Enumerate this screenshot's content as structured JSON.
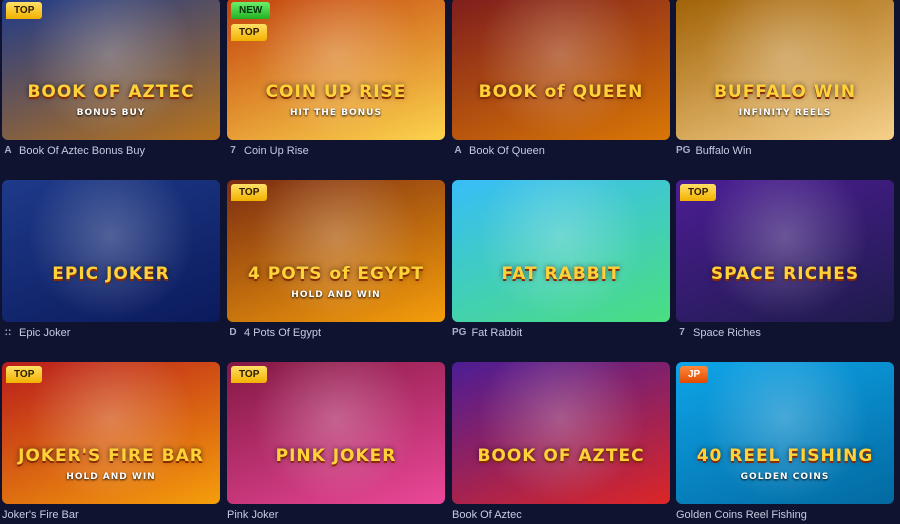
{
  "games": [
    {
      "title": "Book Of Aztec Bonus Buy",
      "art_text": "BOOK OF AZTEC",
      "art_sub": "BONUS BUY",
      "badges": [
        "TOP"
      ],
      "provider_icon": "A",
      "bg": [
        "#1e3a8a",
        "#b8731c"
      ]
    },
    {
      "title": "Coin Up Rise",
      "art_text": "COIN UP RISE",
      "art_sub": "HIT THE BONUS",
      "badges": [
        "NEW",
        "TOP"
      ],
      "provider_icon": "7",
      "bg": [
        "#c2410c",
        "#fcd34d"
      ]
    },
    {
      "title": "Book Of Queen",
      "art_text": "BOOK of QUEEN",
      "art_sub": "",
      "badges": [],
      "provider_icon": "A",
      "bg": [
        "#7f1d1d",
        "#d97706"
      ]
    },
    {
      "title": "Buffalo Win",
      "art_text": "BUFFALO WIN",
      "art_sub": "INFINITY REELS",
      "badges": [],
      "provider_icon": "PG",
      "bg": [
        "#a16207",
        "#f5d08a"
      ]
    },
    {
      "title": "Epic Joker",
      "art_text": "EPIC JOKER",
      "art_sub": "",
      "badges": [],
      "provider_icon": "::",
      "bg": [
        "#1e3a8a",
        "#0b1a5c"
      ]
    },
    {
      "title": "4 Pots Of Egypt",
      "art_text": "4 POTS of EGYPT",
      "art_sub": "HOLD AND WIN",
      "badges": [
        "TOP"
      ],
      "provider_icon": "D",
      "bg": [
        "#7c2d12",
        "#f59e0b"
      ]
    },
    {
      "title": "Fat Rabbit",
      "art_text": "FAT RABBIT",
      "art_sub": "",
      "badges": [],
      "provider_icon": "PG",
      "bg": [
        "#38bdf8",
        "#4ade80"
      ]
    },
    {
      "title": "Space Riches",
      "art_text": "SPACE RICHES",
      "art_sub": "",
      "badges": [
        "TOP"
      ],
      "provider_icon": "7",
      "bg": [
        "#4c1d95",
        "#1e1b4b"
      ]
    },
    {
      "title": "Joker's Fire Bar",
      "art_text": "JOKER'S FIRE BAR",
      "art_sub": "HOLD AND WIN",
      "badges": [
        "TOP"
      ],
      "provider_icon": "",
      "bg": [
        "#b91c1c",
        "#f59e0b"
      ]
    },
    {
      "title": "Pink Joker",
      "art_text": "PINK JOKER",
      "art_sub": "",
      "badges": [
        "TOP"
      ],
      "provider_icon": "",
      "bg": [
        "#831843",
        "#ec4899"
      ]
    },
    {
      "title": "Book Of Aztec",
      "art_text": "BOOK OF AZTEC",
      "art_sub": "",
      "badges": [],
      "provider_icon": "",
      "bg": [
        "#4c1d95",
        "#dc2626"
      ]
    },
    {
      "title": "Golden Coins Reel Fishing",
      "art_text": "40 REEL FISHING",
      "art_sub": "GOLDEN COINS",
      "badges": [
        "JP"
      ],
      "provider_icon": "",
      "bg": [
        "#0ea5e9",
        "#0369a1"
      ]
    }
  ]
}
